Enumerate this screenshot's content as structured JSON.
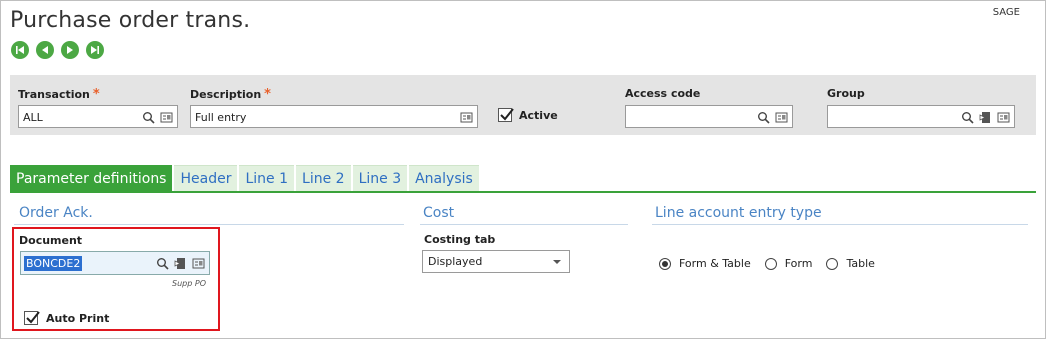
{
  "page": {
    "title": "Purchase order trans.",
    "folder": "SAGE"
  },
  "nav": [
    "first-record-icon",
    "previous-record-icon",
    "next-record-icon",
    "last-record-icon"
  ],
  "filters": {
    "transaction": {
      "label": "Transaction",
      "required": "*",
      "value": "ALL"
    },
    "description": {
      "label": "Description",
      "required": "*",
      "value": "Full entry"
    },
    "active": {
      "label": "Active",
      "checked": true
    },
    "access_code": {
      "label": "Access code",
      "value": ""
    },
    "group": {
      "label": "Group",
      "value": ""
    }
  },
  "tabs": [
    {
      "label": "Parameter definitions",
      "active": true
    },
    {
      "label": "Header",
      "active": false
    },
    {
      "label": "Line 1",
      "active": false
    },
    {
      "label": "Line 2",
      "active": false
    },
    {
      "label": "Line 3",
      "active": false
    },
    {
      "label": "Analysis",
      "active": false
    }
  ],
  "sections": {
    "order_ack": {
      "title": "Order Ack.",
      "document_label": "Document",
      "document_value": "BONCDE2",
      "document_subtext": "Supp PO",
      "auto_print_label": "Auto Print",
      "auto_print_checked": true
    },
    "cost": {
      "title": "Cost",
      "costing_tab_label": "Costing tab",
      "costing_tab_value": "Displayed"
    },
    "line_account": {
      "title": "Line account entry type",
      "options": [
        "Form & Table",
        "Form",
        "Table"
      ],
      "selected": "Form & Table"
    }
  },
  "colors": {
    "accent_green": "#3aa23a",
    "link_blue": "#4a84c4",
    "highlight_red": "#e0161e"
  }
}
